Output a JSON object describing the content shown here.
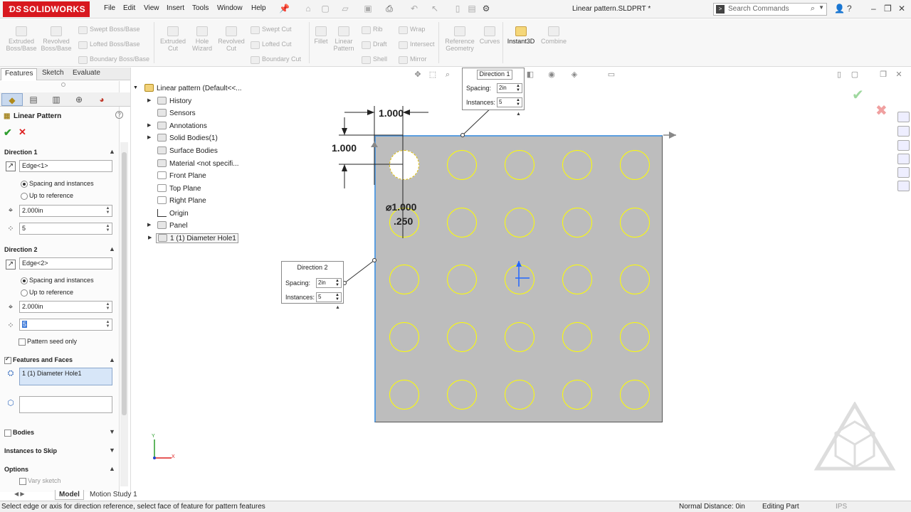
{
  "app": {
    "brand": "SOLIDWORKS",
    "document_title": "Linear pattern.SLDPRT *"
  },
  "menu": [
    "File",
    "Edit",
    "View",
    "Insert",
    "Tools",
    "Window",
    "Help"
  ],
  "search": {
    "placeholder": "Search Commands"
  },
  "commands": {
    "extruded_boss": "Extruded Boss/Base",
    "revolved_boss": "Revolved Boss/Base",
    "swept_boss": "Swept Boss/Base",
    "lofted_boss": "Lofted Boss/Base",
    "boundary_boss": "Boundary Boss/Base",
    "extruded_cut": "Extruded Cut",
    "hole_wizard": "Hole Wizard",
    "revolved_cut": "Revolved Cut",
    "swept_cut": "Swept Cut",
    "lofted_cut": "Lofted Cut",
    "boundary_cut": "Boundary Cut",
    "fillet": "Fillet",
    "linear_pattern": "Linear Pattern",
    "rib": "Rib",
    "draft": "Draft",
    "shell": "Shell",
    "wrap": "Wrap",
    "intersect": "Intersect",
    "mirror": "Mirror",
    "reference_geometry": "Reference Geometry",
    "curves": "Curves",
    "instant3d": "Instant3D",
    "combine": "Combine"
  },
  "tabs": [
    "Features",
    "Sketch",
    "Evaluate"
  ],
  "property_manager": {
    "title": "Linear Pattern",
    "direction1": {
      "title": "Direction 1",
      "edge": "Edge<1>",
      "option_spacing": "Spacing and instances",
      "option_reference": "Up to reference",
      "spacing": "2.000in",
      "instances": "5"
    },
    "direction2": {
      "title": "Direction 2",
      "edge": "Edge<2>",
      "option_spacing": "Spacing and instances",
      "option_reference": "Up to reference",
      "spacing": "2.000in",
      "instances": "5",
      "pattern_seed_only": "Pattern seed only"
    },
    "features_faces": {
      "title": "Features and Faces",
      "item": "1 (1) Diameter Hole1"
    },
    "bodies": "Bodies",
    "instances_to_skip": "Instances to Skip",
    "options": {
      "title": "Options",
      "vary_sketch": "Vary sketch"
    }
  },
  "tree": {
    "root": "Linear pattern  (Default<<...",
    "items": [
      "History",
      "Sensors",
      "Annotations",
      "Solid Bodies(1)",
      "Surface Bodies",
      "Material <not specifi...",
      "Front Plane",
      "Top Plane",
      "Right Plane",
      "Origin",
      "Panel",
      "1 (1) Diameter Hole1"
    ]
  },
  "callout_dir1": {
    "title": "Direction 1",
    "spacing_label": "Spacing:",
    "spacing": "2in",
    "instances_label": "Instances:",
    "instances": "5"
  },
  "callout_dir2": {
    "title": "Direction 2",
    "spacing_label": "Spacing:",
    "spacing": "2in",
    "instances_label": "Instances:",
    "instances": "5"
  },
  "dimensions": {
    "horizontal": "1.000",
    "vertical": "1.000",
    "diameter": "⌀1.000",
    "depth": ".250"
  },
  "axis": {
    "x": "X",
    "y": "Y"
  },
  "bottom_tabs": [
    "Model",
    "Motion Study 1"
  ],
  "status": {
    "message": "Select edge or axis for direction reference, select face of feature for pattern features",
    "normal_distance": "Normal Distance: 0in",
    "mode": "Editing Part",
    "units": "IPS"
  },
  "colors": {
    "brand_red": "#d8181f",
    "panel_gray": "#bdbdbd",
    "hole_yellow": "#ffff00",
    "selection_blue": "#5b9ee0"
  }
}
